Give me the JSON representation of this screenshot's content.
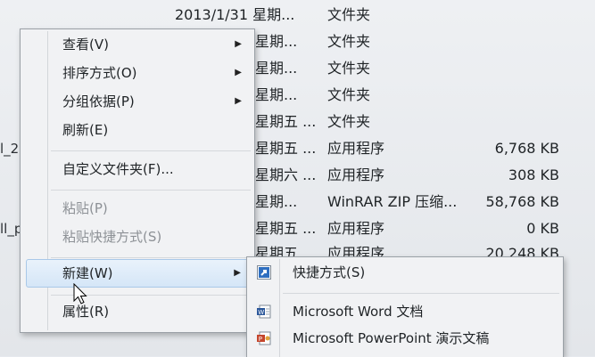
{
  "file_rows": [
    {
      "date": "2013/1/31 星期...",
      "type": "文件夹",
      "size": ""
    },
    {
      "date": "星期...",
      "type": "文件夹",
      "size": ""
    },
    {
      "date": "星期...",
      "type": "文件夹",
      "size": ""
    },
    {
      "date": "星期...",
      "type": "文件夹",
      "size": ""
    },
    {
      "date": "星期五 ...",
      "type": "文件夹",
      "size": ""
    },
    {
      "date": "星期五 ...",
      "type": "应用程序",
      "size": "6,768 KB"
    },
    {
      "date": "星期六 ...",
      "type": "应用程序",
      "size": "308 KB"
    },
    {
      "date": "星期...",
      "type": "WinRAR ZIP 压缩...",
      "size": "58,768 KB"
    },
    {
      "date": "星期五 ...",
      "type": "应用程序",
      "size": "0 KB"
    },
    {
      "date": "星期五 ...",
      "type": "应用程序",
      "size": "20,248 KB"
    }
  ],
  "left_fragments": [
    "l_2",
    "ll_p"
  ],
  "context_menu": {
    "view": "查看(V)",
    "sort": "排序方式(O)",
    "group": "分组依据(P)",
    "refresh": "刷新(E)",
    "customize": "自定义文件夹(F)...",
    "paste": "粘贴(P)",
    "paste_shortcut": "粘贴快捷方式(S)",
    "new": "新建(W)",
    "properties": "属性(R)"
  },
  "new_submenu": {
    "shortcut": "快捷方式(S)",
    "word": "Microsoft Word 文档",
    "powerpoint": "Microsoft PowerPoint 演示文稿"
  },
  "icons": {
    "submenu_arrow": "chevron-right-icon",
    "shortcut": "shortcut-icon",
    "word": "word-document-icon",
    "powerpoint": "powerpoint-document-icon",
    "cursor": "mouse-pointer-icon"
  },
  "colors": {
    "menu_bg": "#f1f2f4",
    "hover_bg": "#d5e6f7",
    "hover_border": "#a9c8e8",
    "disabled_text": "#8d9196"
  }
}
